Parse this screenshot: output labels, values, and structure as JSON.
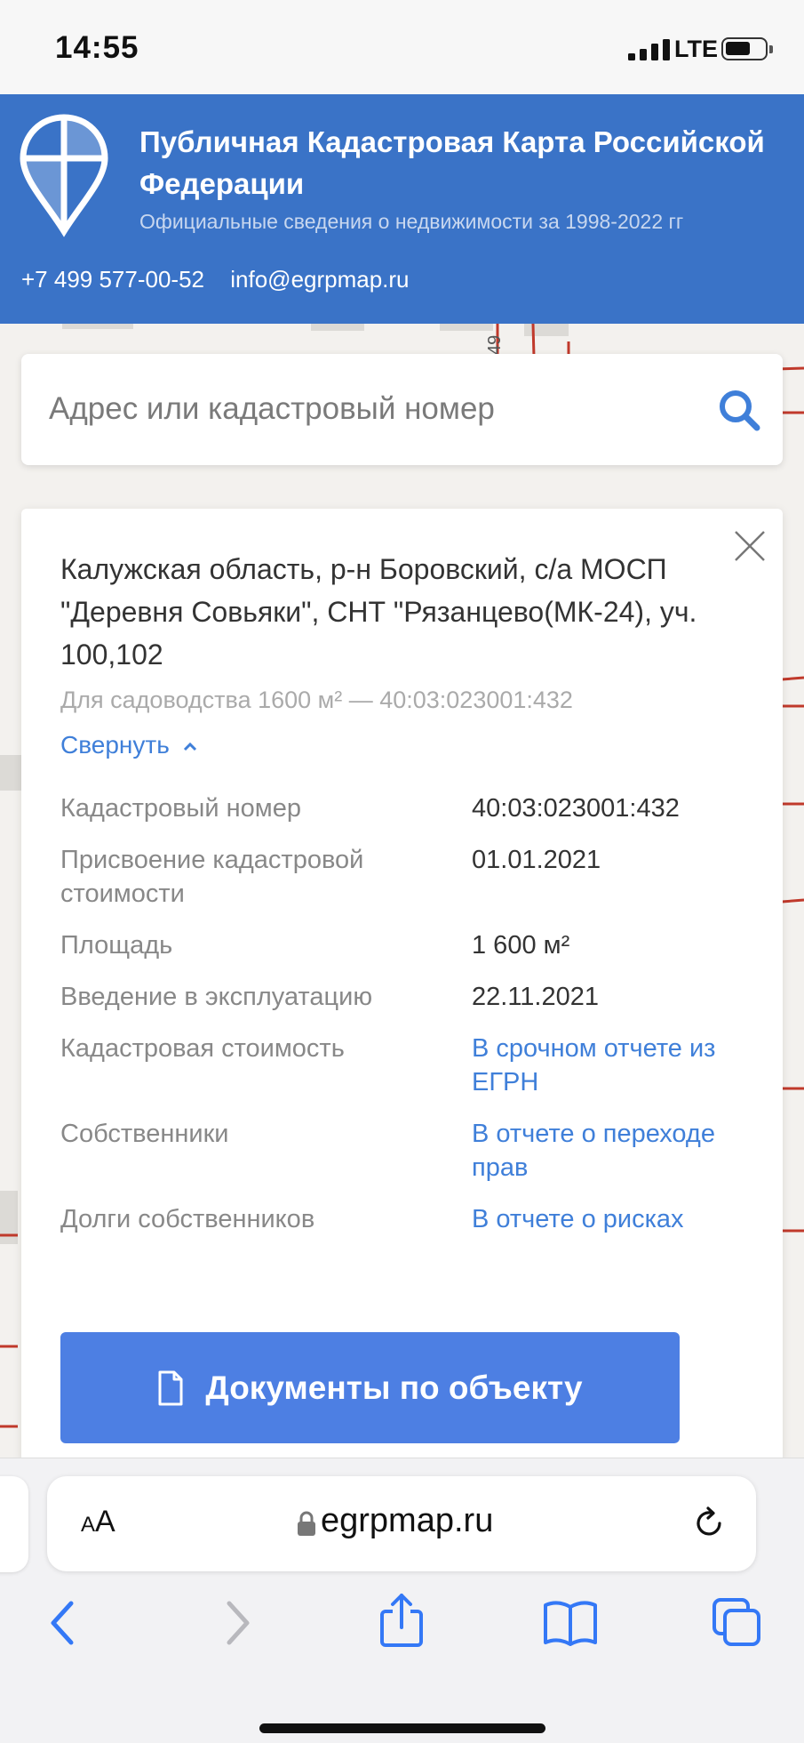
{
  "status_bar": {
    "time": "14:55",
    "network": "LTE"
  },
  "header": {
    "title": "Публичная Кадастровая Карта Российской Федерации",
    "subtitle": "Официальные сведения о недвижимости за 1998-2022 гг",
    "phone": "+7 499 577-00-52",
    "email": "info@egrpmap.ru"
  },
  "search": {
    "placeholder": "Адрес или кадастровый номер"
  },
  "card": {
    "address": "Калужская область, р-н Боровский, с/а МОСП \"Деревня Совьяки\", СНТ \"Рязанцево(МК-24), уч. 100,102",
    "summary": "Для садоводства 1600 м² — 40:03:023001:432",
    "collapse_label": "Свернуть",
    "rows": [
      {
        "label": "Кадастровый номер",
        "value": "40:03:023001:432"
      },
      {
        "label": "Присвоение кадастровой стоимости",
        "value": "01.01.2021"
      },
      {
        "label": "Площадь",
        "value": "1 600 м²"
      },
      {
        "label": "Введение в эксплуатацию",
        "value": "22.11.2021"
      },
      {
        "label": "Кадастровая стоимость",
        "value": "В срочном отчете из ЕГРН"
      },
      {
        "label": "Собственники",
        "value": "В отчете о переходе прав"
      },
      {
        "label": "Долги собственников",
        "value": "В отчете о рисках"
      }
    ],
    "documents_button": "Документы по объекту"
  },
  "map": {
    "label_fragment": "49"
  },
  "browser": {
    "text_size_label_small": "A",
    "text_size_label_large": "A",
    "url": "egrpmap.ru"
  },
  "colors": {
    "header_bg": "#3a73c7",
    "accent": "#3f7fd9",
    "button_bg": "#4d7fe3",
    "parcel_line": "#c0392b"
  }
}
